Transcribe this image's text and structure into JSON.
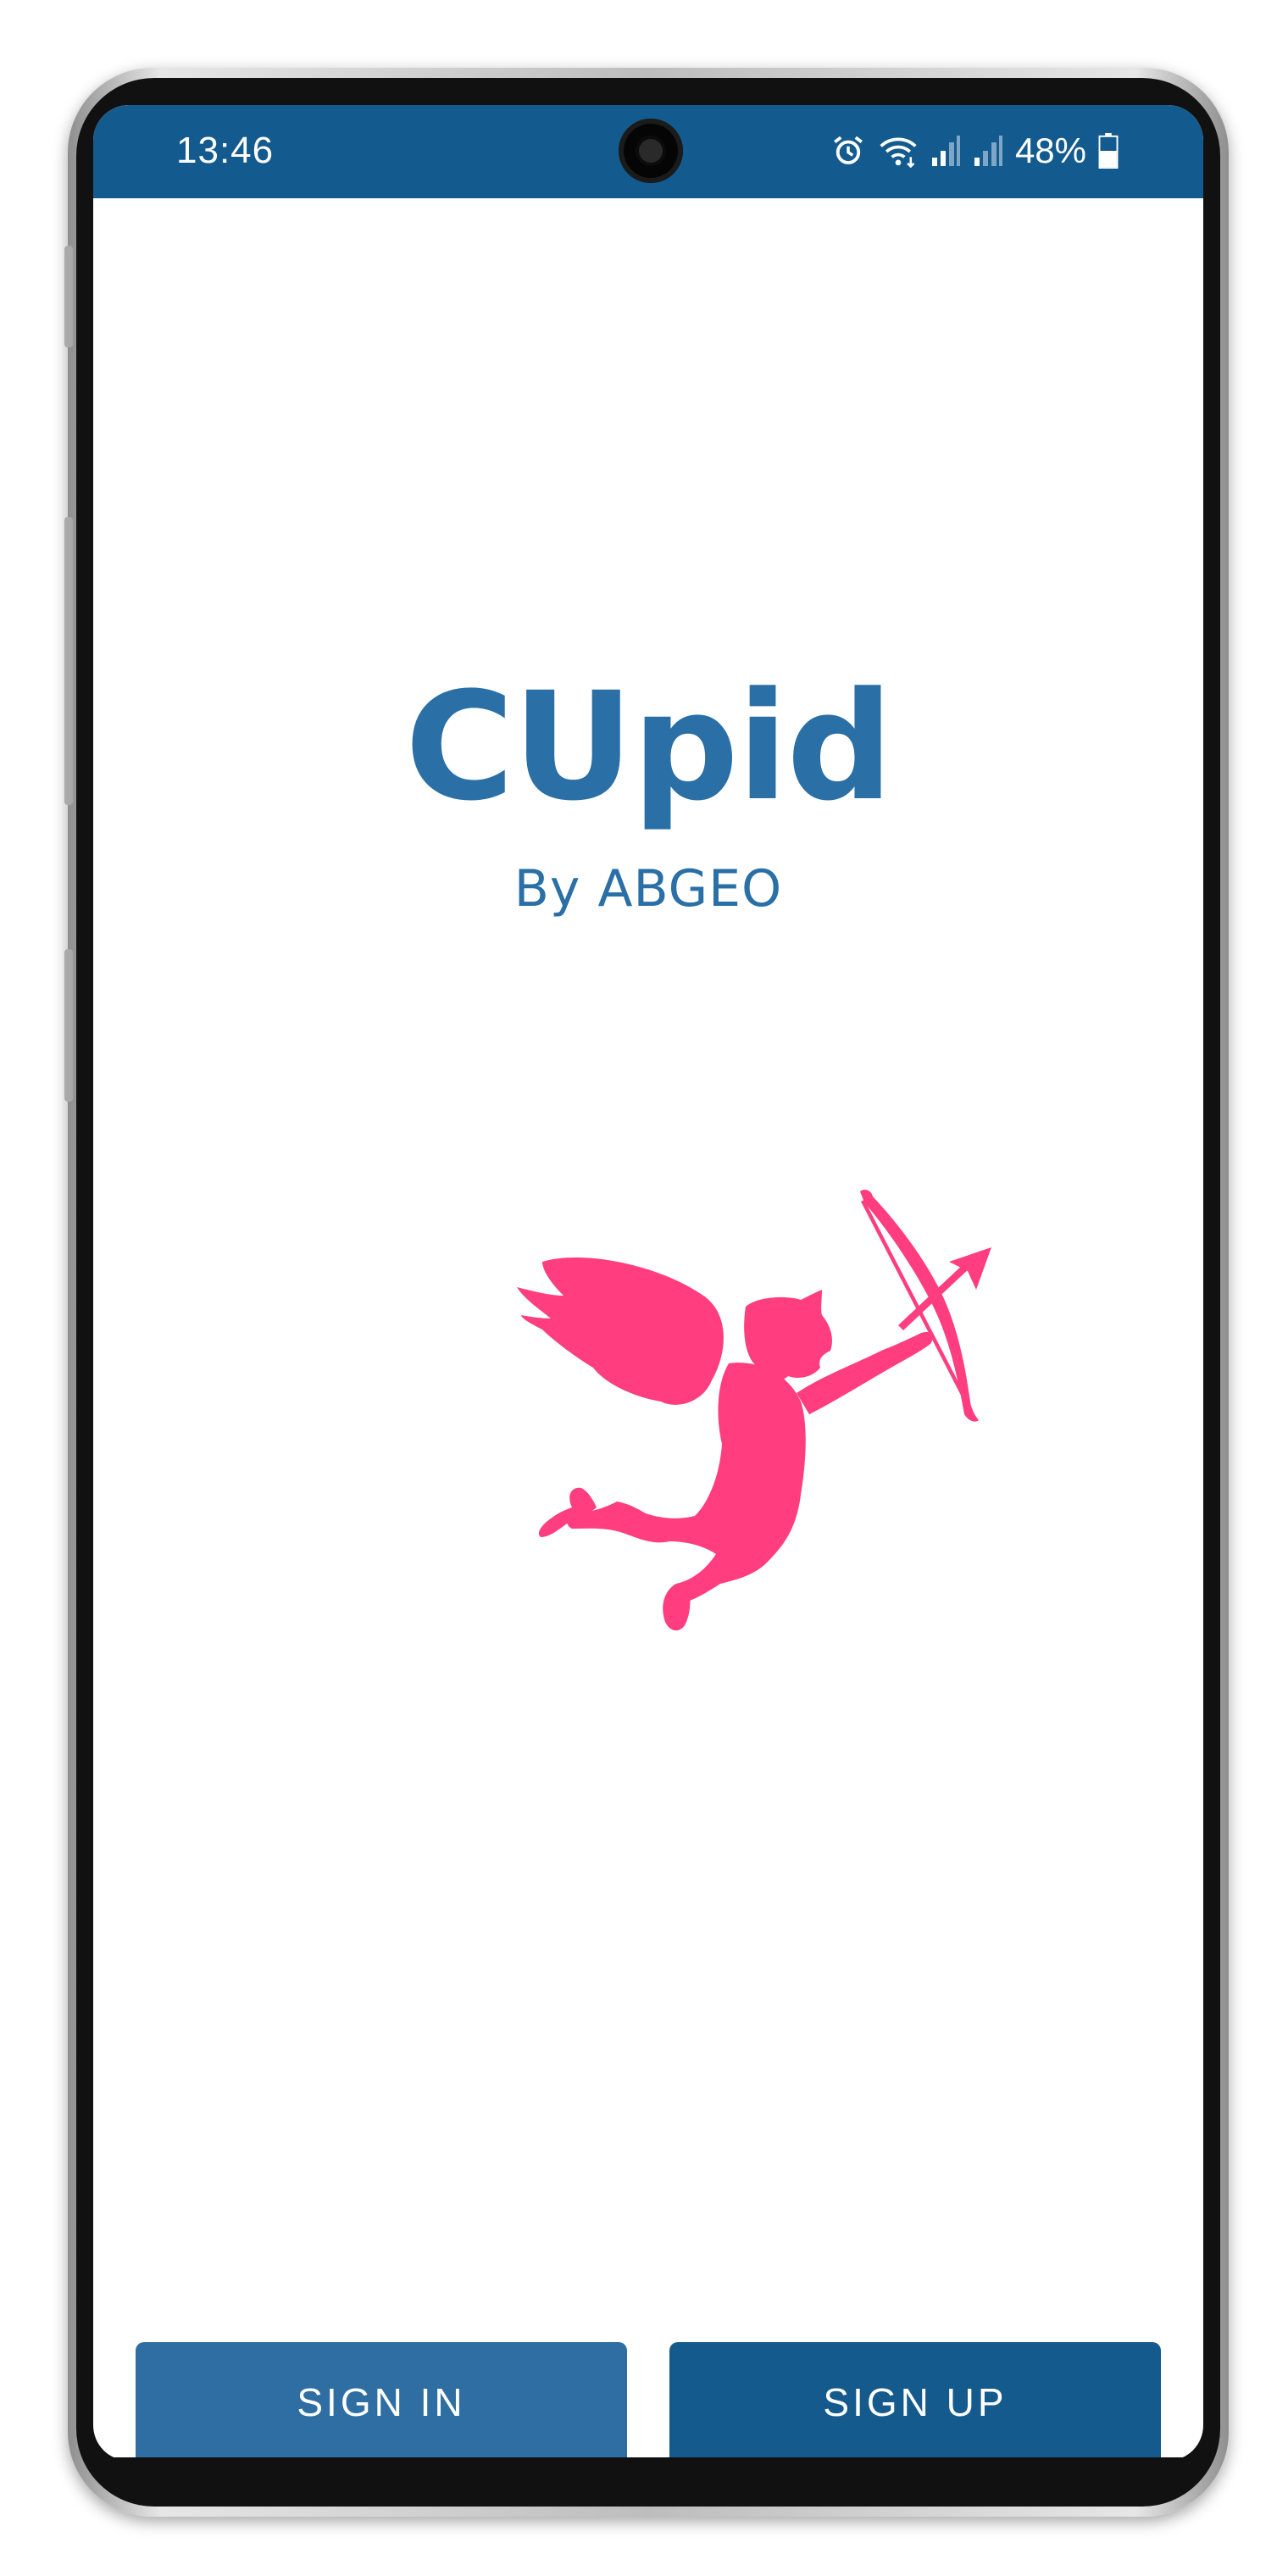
{
  "status_bar": {
    "time": "13:46",
    "battery_percent": "48%",
    "icons": [
      "alarm-icon",
      "wifi-icon",
      "signal-icon",
      "signal-icon",
      "battery-icon"
    ],
    "background_color": "#135b8e"
  },
  "header": {
    "title": "CUpid",
    "subtitle": "By ABGEO"
  },
  "hero_image": {
    "icon": "cupid-icon",
    "color": "#ff3d7f"
  },
  "actions": {
    "sign_in_label": "SIGN IN",
    "sign_up_label": "SIGN UP",
    "sign_in_color": "#2e6ea3",
    "sign_up_color": "#155a8c"
  }
}
